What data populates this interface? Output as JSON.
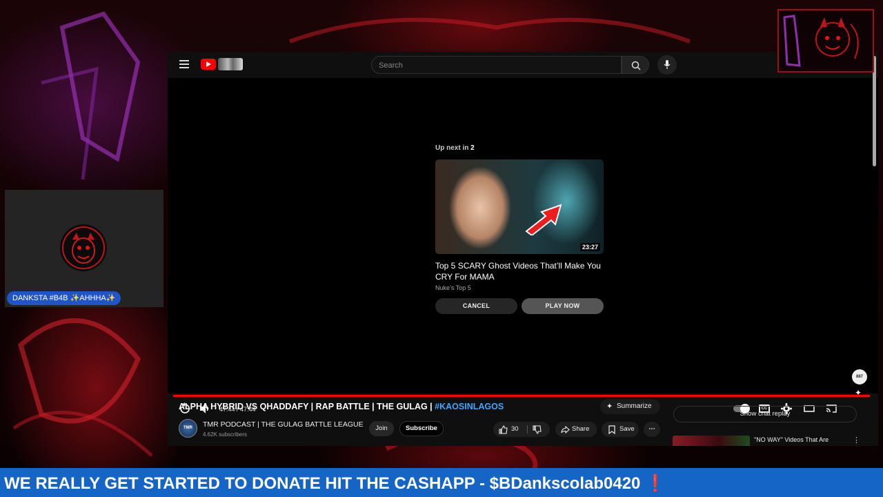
{
  "youtube": {
    "search": {
      "placeholder": "Search"
    },
    "up_next": {
      "label_prefix": "Up next in",
      "countdown": "2",
      "title": "Top 5 SCARY Ghost Videos That’ll Make You CRY For MAMA",
      "channel": "Nuke’s Top 5",
      "duration": "23:27",
      "cancel_label": "CANCEL",
      "play_label": "PLAY NOW"
    },
    "player": {
      "time": "47:44 / 47:44",
      "progress": 1.0
    },
    "video": {
      "title": "ALPHA HYBRID VS QHADDAFY | RAP BATTLE | THE GULAG | ",
      "hashtag": "#KAOSINLAGOS",
      "summarize_label": "Summarize",
      "channel_name": "TMR PODCAST | THE GULAG BATTLE LEAGUE",
      "channel_subs": "4.62K subscribers",
      "channel_avatar_text": "TMR",
      "join_label": "Join",
      "subscribe_label": "Subscribe",
      "like_count": "30",
      "share_label": "Share",
      "save_label": "Save",
      "more_label": "⋯"
    },
    "sidebar": {
      "chat_replay_label": "Show chat replay",
      "recommended_title": "\"NO WAY\" Videos That Are"
    }
  },
  "overlay": {
    "webcam_name": "DANKSTA #B4B ✨AHHHA✨",
    "ticker_text": "WE REALLY GET STARTED TO DONATE HIT THE CASHAPP - $BDankscolab0420 ",
    "ticker_mark": "❗",
    "float_widget_text": "887",
    "brand_colors": {
      "red": "#ff0000",
      "ticker_blue": "#1565c7",
      "badge_blue": "#1f55c9",
      "link_blue": "#3ea6ff"
    }
  }
}
